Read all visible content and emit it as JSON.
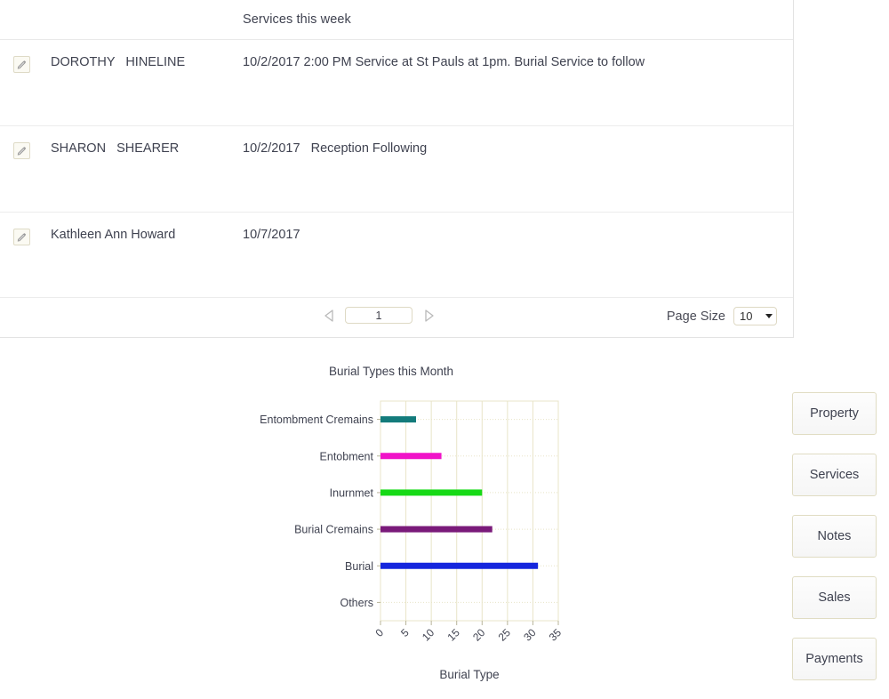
{
  "services_grid": {
    "column_header": "Services this week",
    "rows": [
      {
        "edit_icon": "pencil-edit-icon",
        "name": "DOROTHY   HINELINE",
        "description": "10/2/2017 2:00 PM Service at St Pauls at 1pm. Burial Service to follow"
      },
      {
        "edit_icon": "pencil-edit-icon",
        "name": "SHARON   SHEARER",
        "description": "10/2/2017   Reception Following"
      },
      {
        "edit_icon": "pencil-edit-icon",
        "name": "Kathleen Ann Howard",
        "description": "10/7/2017"
      }
    ],
    "pager": {
      "prev_icon": "triangle-left-icon",
      "next_icon": "triangle-right-icon",
      "page_number": "1",
      "page_size_label": "Page Size",
      "page_size_value": "10",
      "page_size_caret_icon": "caret-down-icon"
    }
  },
  "side_buttons": [
    {
      "label": "Property"
    },
    {
      "label": "Services"
    },
    {
      "label": "Notes"
    },
    {
      "label": "Sales"
    },
    {
      "label": "Payments"
    }
  ],
  "chart_data": {
    "type": "bar",
    "orientation": "horizontal",
    "title": "Burial Types this Month",
    "xlabel": "Burial Type",
    "ylabel": "",
    "categories": [
      "Others",
      "Burial",
      "Burial Cremains",
      "Inurnmet",
      "Entobment",
      "Entombment Cremains"
    ],
    "values": [
      0,
      31,
      22,
      20,
      12,
      7
    ],
    "colors": [
      "#c0c0c0",
      "#1526dd",
      "#7a1a7a",
      "#16d916",
      "#f013c8",
      "#137b7b"
    ],
    "xlim": [
      0,
      35
    ],
    "xticks": [
      0,
      5,
      10,
      15,
      20,
      25,
      30,
      35
    ],
    "xtick_labels": [
      "0",
      "5",
      "10",
      "15",
      "20",
      "25",
      "30",
      "35"
    ],
    "xtick_rotation": -45,
    "grid": true,
    "grid_color": "#e8e4c8",
    "legend": "none"
  }
}
